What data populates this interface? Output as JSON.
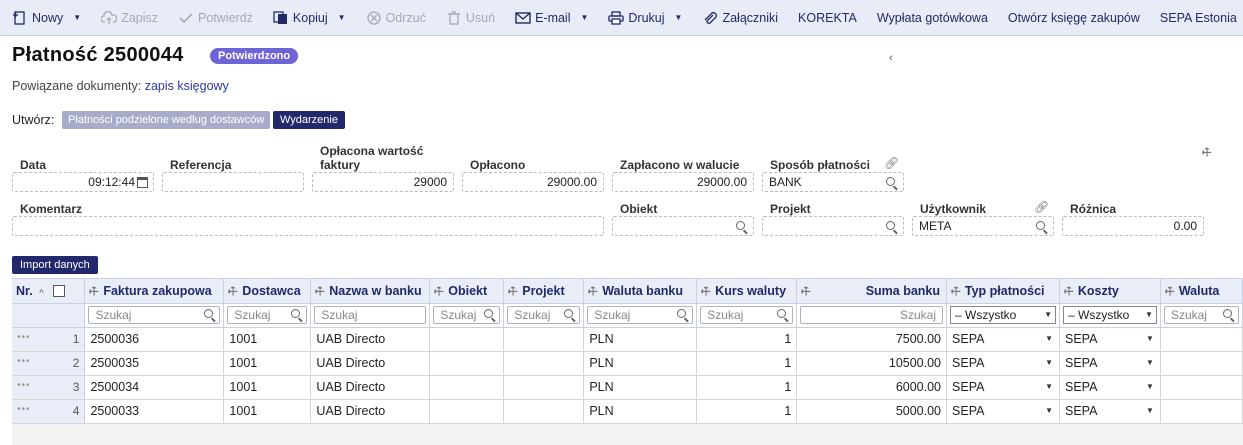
{
  "toolbar": {
    "items": [
      {
        "label": "Nowy",
        "icon": "new-document-icon",
        "caret": true,
        "disabled": false
      },
      {
        "label": "Zapisz",
        "icon": "cloud-upload-icon",
        "caret": false,
        "disabled": true
      },
      {
        "label": "Potwierdź",
        "icon": "check-icon",
        "caret": false,
        "disabled": true
      },
      {
        "label": "Kopiuj",
        "icon": "copy-icon",
        "caret": true,
        "disabled": false
      },
      {
        "label": "Odrzuć",
        "icon": "cancel-circle-icon",
        "caret": false,
        "disabled": true
      },
      {
        "label": "Usuń",
        "icon": "trash-icon",
        "caret": false,
        "disabled": true
      },
      {
        "label": "E-mail",
        "icon": "envelope-icon",
        "caret": true,
        "disabled": false
      },
      {
        "label": "Drukuj",
        "icon": "printer-icon",
        "caret": true,
        "disabled": false
      },
      {
        "label": "Załączniki",
        "icon": "paperclip-icon",
        "caret": false,
        "disabled": false
      },
      {
        "label": "KOREKTA",
        "icon": "",
        "caret": false,
        "disabled": false
      },
      {
        "label": "Wypłata gotówkowa",
        "icon": "",
        "caret": false,
        "disabled": false
      },
      {
        "label": "Otwórz księgę zakupów",
        "icon": "",
        "caret": false,
        "disabled": false
      },
      {
        "label": "SEPA Estonia",
        "icon": "",
        "caret": false,
        "disabled": false
      }
    ]
  },
  "header": {
    "title": "Płatność 2500044",
    "status": "Potwierdzono",
    "mark": "‹",
    "related_label": "Powiązane dokumenty:",
    "related_link": "zapis księgowy",
    "create_label": "Utwórz:",
    "create_buttons": [
      "Płatności podzielone według dostawców",
      "Wydarzenie"
    ]
  },
  "form": {
    "data_label": "Data",
    "data_value": "09:12:44",
    "referencja_label": "Referencja",
    "referencja_value": "",
    "oplacona_label_1": "Opłacona wartość",
    "oplacona_label_2": "faktury",
    "oplacona_value": "29000",
    "oplacono_label": "Opłacono",
    "oplacono_value": "29000.00",
    "zaplacono_label": "Zapłacono w walucie",
    "zaplacono_value": "29000.00",
    "sposob_label": "Sposób płatności",
    "sposob_value": "BANK",
    "komentarz_label": "Komentarz",
    "komentarz_value": "",
    "obiekt_label": "Obiekt",
    "obiekt_value": "",
    "projekt_label": "Projekt",
    "projekt_value": "",
    "uzytkownik_label": "Użytkownik",
    "uzytkownik_value": "META",
    "roznica_label": "Różnica",
    "roznica_value": "0.00"
  },
  "import_button": "Import danych",
  "grid": {
    "columns": [
      "Nr.",
      "Faktura zakupowa",
      "Dostawca",
      "Nazwa w banku",
      "Obiekt",
      "Projekt",
      "Waluta banku",
      "Kurs waluty",
      "Suma banku",
      "Typ płatności",
      "Koszty",
      "Waluta"
    ],
    "search_placeholder": "Szukaj",
    "select_all": "– Wszystko",
    "rows": [
      {
        "nr": "1",
        "faktura": "2500036",
        "dostawca": "1001",
        "nazwa": "UAB Directo",
        "obiekt": "",
        "projekt": "",
        "waluta_banku": "PLN",
        "kurs": "1",
        "suma": "7500.00",
        "typ": "SEPA",
        "koszty": "SEPA",
        "waluta": ""
      },
      {
        "nr": "2",
        "faktura": "2500035",
        "dostawca": "1001",
        "nazwa": "UAB Directo",
        "obiekt": "",
        "projekt": "",
        "waluta_banku": "PLN",
        "kurs": "1",
        "suma": "10500.00",
        "typ": "SEPA",
        "koszty": "SEPA",
        "waluta": ""
      },
      {
        "nr": "3",
        "faktura": "2500034",
        "dostawca": "1001",
        "nazwa": "UAB Directo",
        "obiekt": "",
        "projekt": "",
        "waluta_banku": "PLN",
        "kurs": "1",
        "suma": "6000.00",
        "typ": "SEPA",
        "koszty": "SEPA",
        "waluta": ""
      },
      {
        "nr": "4",
        "faktura": "2500033",
        "dostawca": "1001",
        "nazwa": "UAB Directo",
        "obiekt": "",
        "projekt": "",
        "waluta_banku": "PLN",
        "kurs": "1",
        "suma": "5000.00",
        "typ": "SEPA",
        "koszty": "SEPA",
        "waluta": ""
      }
    ]
  }
}
